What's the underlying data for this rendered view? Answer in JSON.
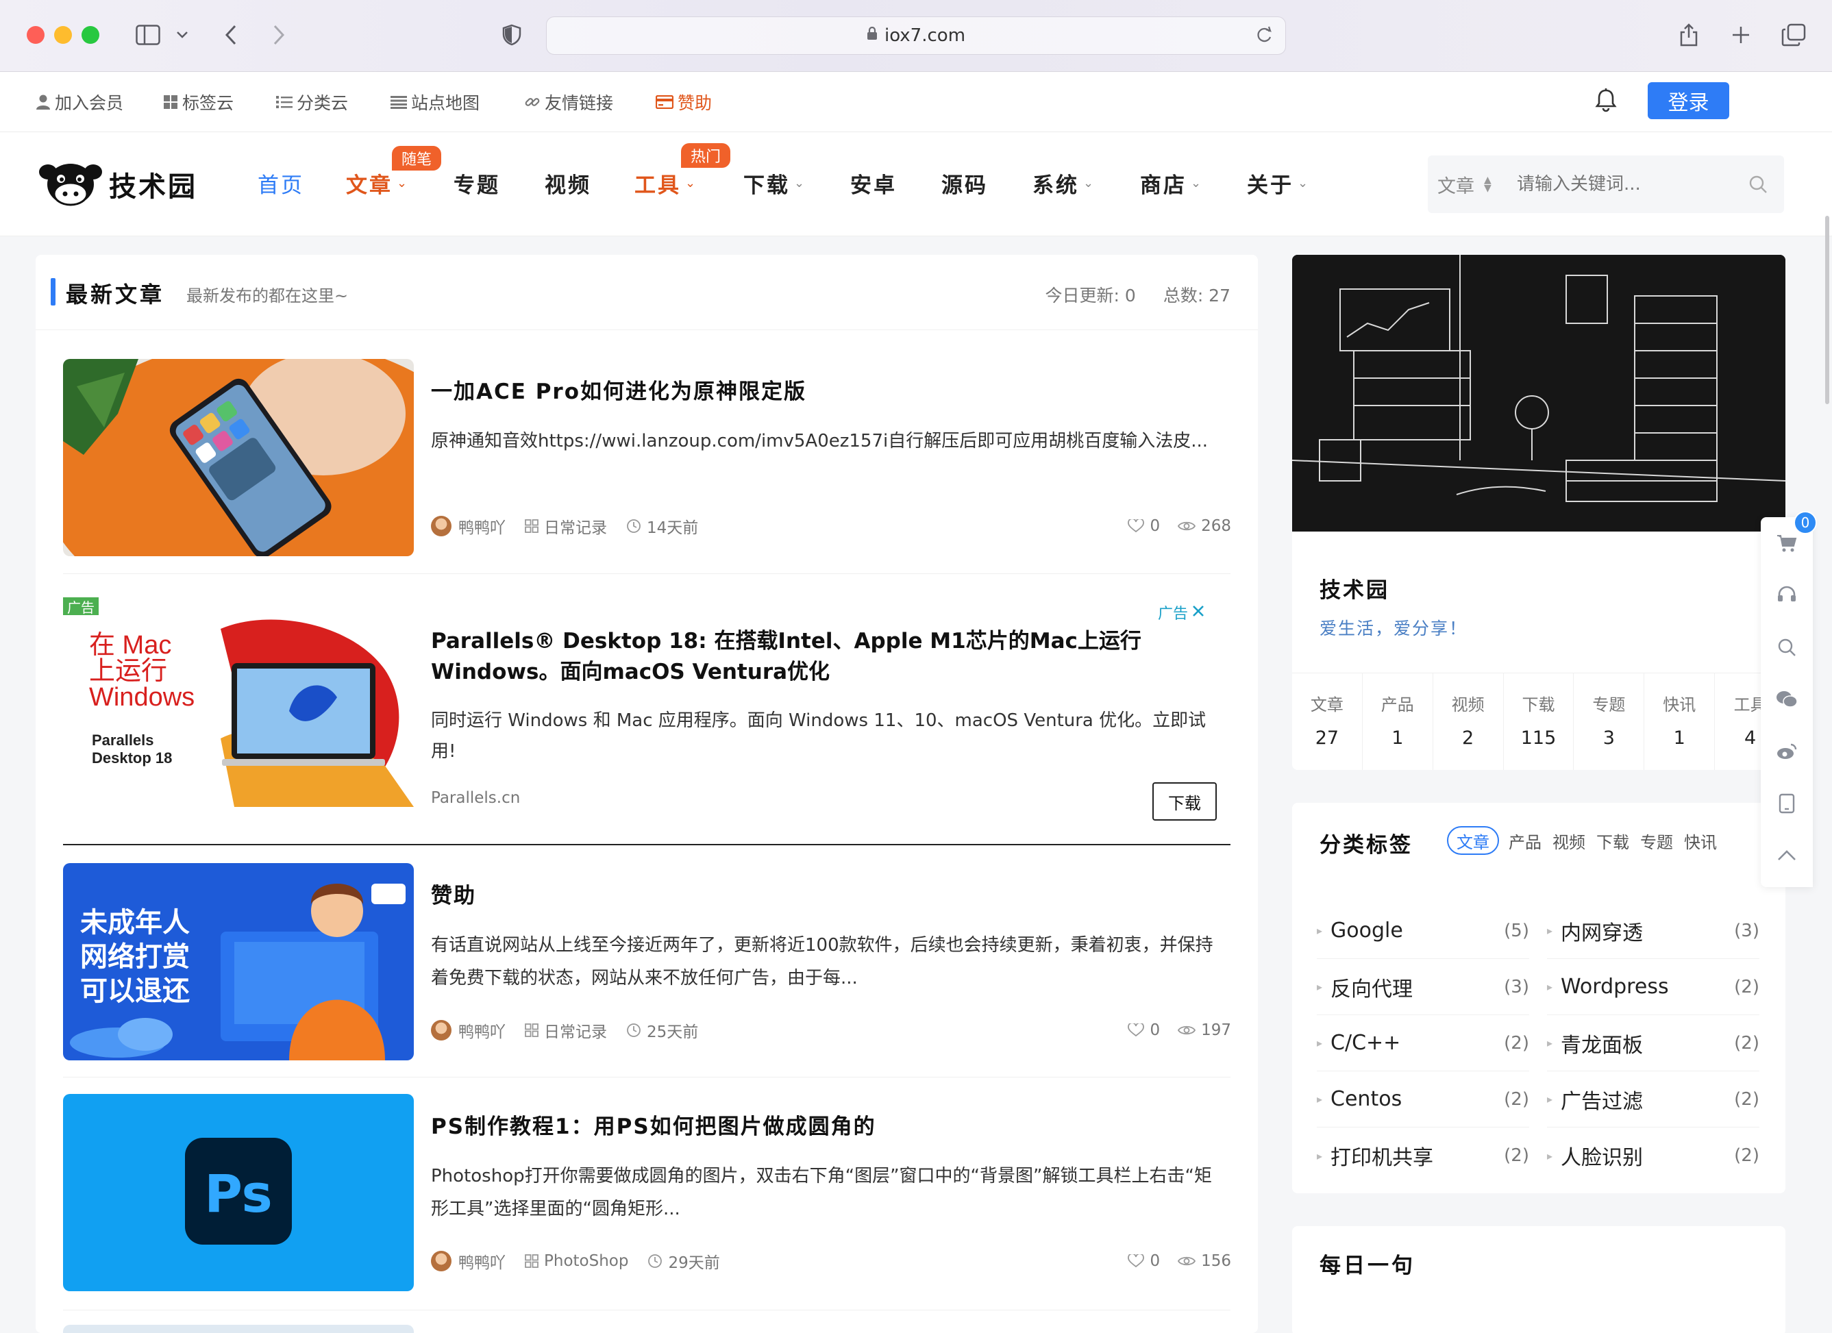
{
  "browser": {
    "url": "iox7.com"
  },
  "topbar": {
    "items": [
      {
        "label": "加入会员",
        "icon": "user-icon"
      },
      {
        "label": "标签云",
        "icon": "grid-icon"
      },
      {
        "label": "分类云",
        "icon": "list-icon"
      },
      {
        "label": "站点地图",
        "icon": "menu-icon"
      },
      {
        "label": "友情链接",
        "icon": "link-icon"
      },
      {
        "label": "赞助",
        "icon": "card-icon"
      }
    ],
    "login_label": "登录"
  },
  "logo": {
    "text": "技术园"
  },
  "nav": {
    "items": [
      {
        "label": "首页"
      },
      {
        "label": "文章",
        "badge": "随笔"
      },
      {
        "label": "专题"
      },
      {
        "label": "视频"
      },
      {
        "label": "工具",
        "badge": "热门"
      },
      {
        "label": "下载"
      },
      {
        "label": "安卓"
      },
      {
        "label": "源码"
      },
      {
        "label": "系统"
      },
      {
        "label": "商店"
      },
      {
        "label": "关于"
      }
    ],
    "search": {
      "scope": "文章",
      "placeholder": "请输入关键词..."
    }
  },
  "latest": {
    "title": "最新文章",
    "subtitle": "最新发布的都在这里~",
    "today_label": "今日更新: 0",
    "total_label": "总数: 27"
  },
  "posts": [
    {
      "title": "一加ACE Pro如何进化为原神限定版",
      "excerpt": "原神通知音效https://wwi.lanzoup.com/imv5A0ez157i自行解压后即可应用胡桃百度输入法皮...",
      "author": "鸭鸭吖",
      "category": "日常记录",
      "time": "14天前",
      "likes": "0",
      "views": "268"
    },
    {
      "title": "赞助",
      "excerpt": "有话直说网站从上线至今接近两年了，更新将近100款软件，后续也会持续更新，秉着初衷，并保持着免费下载的状态，网站从来不放任何广告，由于每...",
      "author": "鸭鸭吖",
      "category": "日常记录",
      "time": "25天前",
      "likes": "0",
      "views": "197",
      "thumb_text": "未成年人\n网络打赏\n可以退还"
    },
    {
      "title": "PS制作教程1：用PS如何把图片做成圆角的",
      "excerpt": "Photoshop打开你需要做成圆角的图片，双击右下角“图层”窗口中的“背景图”解锁工具栏上右击“矩形工具”选择里面的“圆角矩形...",
      "author": "鸭鸭吖",
      "category": "PhotoShop",
      "time": "29天前",
      "likes": "0",
      "views": "156",
      "thumb_text": "Ps"
    }
  ],
  "ad": {
    "tag": "广告",
    "image_text_1": "在 Mac",
    "image_text_2": "上运行",
    "image_text_3": "Windows",
    "image_brand": "Parallels",
    "image_brand_2": "Desktop 18",
    "title": "Parallels® Desktop 18: 在搭载Intel、Apple M1芯片的Mac上运行Windows。面向macOS Ventura优化",
    "desc": "同时运行 Windows 和 Mac 应用程序。面向 Windows 11、10、macOS Ventura 优化。立即试用!",
    "domain": "Parallels.cn",
    "label": "广告",
    "button": "下载"
  },
  "profile": {
    "name": "技术园",
    "motto": "爱生活，爱分享！",
    "stats": [
      {
        "label": "文章",
        "value": "27"
      },
      {
        "label": "产品",
        "value": "1"
      },
      {
        "label": "视频",
        "value": "2"
      },
      {
        "label": "下载",
        "value": "115"
      },
      {
        "label": "专题",
        "value": "3"
      },
      {
        "label": "快讯",
        "value": "1"
      },
      {
        "label": "工具",
        "value": "4"
      }
    ]
  },
  "tags": {
    "title": "分类标签",
    "tabs": [
      "文章",
      "产品",
      "视频",
      "下载",
      "专题",
      "快讯"
    ],
    "items": [
      {
        "name": "Google",
        "count": "(5)"
      },
      {
        "name": "内网穿透",
        "count": "(3)"
      },
      {
        "name": "反向代理",
        "count": "(3)"
      },
      {
        "name": "Wordpress",
        "count": "(2)"
      },
      {
        "name": "C/C++",
        "count": "(2)"
      },
      {
        "name": "青龙面板",
        "count": "(2)"
      },
      {
        "name": "Centos",
        "count": "(2)"
      },
      {
        "name": "广告过滤",
        "count": "(2)"
      },
      {
        "name": "打印机共享",
        "count": "(2)"
      },
      {
        "name": "人脸识别",
        "count": "(2)"
      }
    ]
  },
  "quote": {
    "title": "每日一句"
  },
  "floatbar": {
    "cart_count": "0"
  },
  "colors": {
    "accent": "#2e7cf6",
    "hot": "#e0561b",
    "badge": "#f0612a"
  }
}
